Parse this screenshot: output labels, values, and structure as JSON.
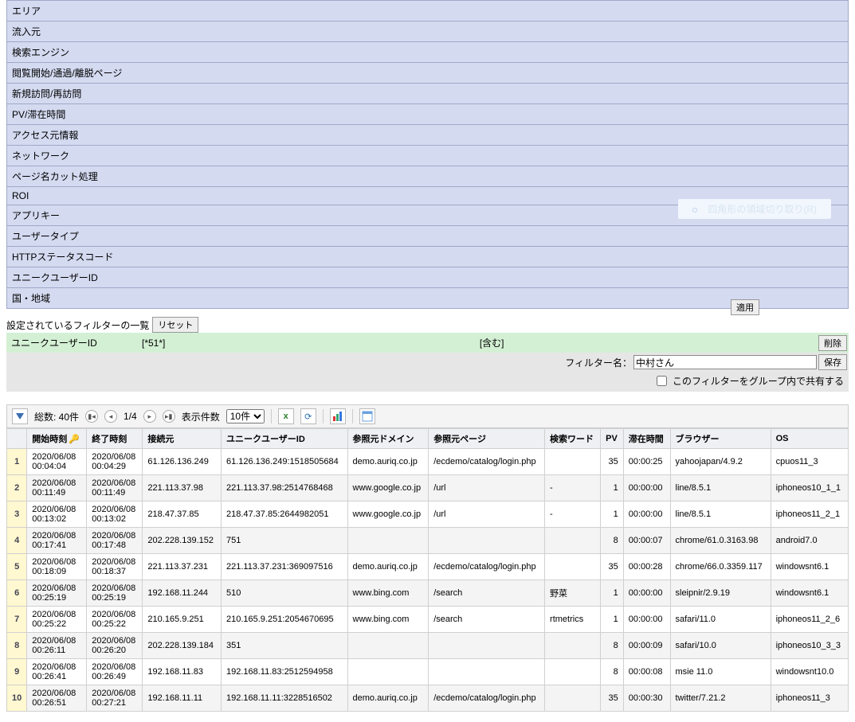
{
  "filters": [
    {
      "label": "エリア"
    },
    {
      "label": "流入元"
    },
    {
      "label": "検索エンジン"
    },
    {
      "label": "閲覧開始/通過/離脱ページ"
    },
    {
      "label": "新規訪問/再訪問"
    },
    {
      "label": "PV/滞在時間"
    },
    {
      "label": "アクセス元情報"
    },
    {
      "label": "ネットワーク"
    },
    {
      "label": "ページ名カット処理"
    },
    {
      "label": "ROI"
    },
    {
      "label": "アプリキー"
    },
    {
      "label": "ユーザータイプ"
    },
    {
      "label": "HTTPステータスコード"
    },
    {
      "label": "ユニークユーザーID"
    },
    {
      "label": "国・地域"
    }
  ],
  "filter_list": {
    "heading": "設定されているフィルターの一覧",
    "reset": "リセット",
    "apply": "適用",
    "type": "ユニークユーザーID",
    "pattern": "[*51*]",
    "mode": "[含む]",
    "delete": "削除"
  },
  "filter_name": {
    "label": "フィルター名：",
    "value": "中村さん",
    "save": "保存",
    "share": "このフィルターをグループ内で共有する"
  },
  "toolbar": {
    "total": "総数: 40件",
    "page": "1/4",
    "perpage_label": "表示件数",
    "perpage_value": "10件"
  },
  "ghost": "四角形の領域切り取り(R)",
  "columns": [
    "開始時刻",
    "終了時刻",
    "接続元",
    "ユニークユーザーID",
    "参照元ドメイン",
    "参照元ページ",
    "検索ワード",
    "PV",
    "滞在時間",
    "ブラウザー",
    "OS"
  ],
  "rows": [
    {
      "n": "1",
      "start": "2020/06/08 00:04:04",
      "end": "2020/06/08 00:04:29",
      "src": "61.126.136.249",
      "uid": "61.126.136.249:1518505684",
      "refd": "demo.auriq.co.jp",
      "refp": "/ecdemo/catalog/login.php",
      "kw": "",
      "pv": "35",
      "dur": "00:00:25",
      "br": "yahoojapan/4.9.2",
      "os": "cpuos11_3"
    },
    {
      "n": "2",
      "start": "2020/06/08 00:11:49",
      "end": "2020/06/08 00:11:49",
      "src": "221.113.37.98",
      "uid": "221.113.37.98:2514768468",
      "refd": "www.google.co.jp",
      "refp": "/url",
      "kw": "-",
      "pv": "1",
      "dur": "00:00:00",
      "br": "line/8.5.1",
      "os": "iphoneos10_1_1"
    },
    {
      "n": "3",
      "start": "2020/06/08 00:13:02",
      "end": "2020/06/08 00:13:02",
      "src": "218.47.37.85",
      "uid": "218.47.37.85:2644982051",
      "refd": "www.google.co.jp",
      "refp": "/url",
      "kw": "-",
      "pv": "1",
      "dur": "00:00:00",
      "br": "line/8.5.1",
      "os": "iphoneos11_2_1"
    },
    {
      "n": "4",
      "start": "2020/06/08 00:17:41",
      "end": "2020/06/08 00:17:48",
      "src": "202.228.139.152",
      "uid": "751",
      "refd": "",
      "refp": "",
      "kw": "",
      "pv": "8",
      "dur": "00:00:07",
      "br": "chrome/61.0.3163.98",
      "os": "android7.0"
    },
    {
      "n": "5",
      "start": "2020/06/08 00:18:09",
      "end": "2020/06/08 00:18:37",
      "src": "221.113.37.231",
      "uid": "221.113.37.231:369097516",
      "refd": "demo.auriq.co.jp",
      "refp": "/ecdemo/catalog/login.php",
      "kw": "",
      "pv": "35",
      "dur": "00:00:28",
      "br": "chrome/66.0.3359.117",
      "os": "windowsnt6.1"
    },
    {
      "n": "6",
      "start": "2020/06/08 00:25:19",
      "end": "2020/06/08 00:25:19",
      "src": "192.168.11.244",
      "uid": "510",
      "refd": "www.bing.com",
      "refp": "/search",
      "kw": "野菜",
      "pv": "1",
      "dur": "00:00:00",
      "br": "sleipnir/2.9.19",
      "os": "windowsnt6.1"
    },
    {
      "n": "7",
      "start": "2020/06/08 00:25:22",
      "end": "2020/06/08 00:25:22",
      "src": "210.165.9.251",
      "uid": "210.165.9.251:2054670695",
      "refd": "www.bing.com",
      "refp": "/search",
      "kw": "rtmetrics",
      "pv": "1",
      "dur": "00:00:00",
      "br": "safari/11.0",
      "os": "iphoneos11_2_6"
    },
    {
      "n": "8",
      "start": "2020/06/08 00:26:11",
      "end": "2020/06/08 00:26:20",
      "src": "202.228.139.184",
      "uid": "351",
      "refd": "",
      "refp": "",
      "kw": "",
      "pv": "8",
      "dur": "00:00:09",
      "br": "safari/10.0",
      "os": "iphoneos10_3_3"
    },
    {
      "n": "9",
      "start": "2020/06/08 00:26:41",
      "end": "2020/06/08 00:26:49",
      "src": "192.168.11.83",
      "uid": "192.168.11.83:2512594958",
      "refd": "",
      "refp": "",
      "kw": "",
      "pv": "8",
      "dur": "00:00:08",
      "br": "msie 11.0",
      "os": "windowsnt10.0"
    },
    {
      "n": "10",
      "start": "2020/06/08 00:26:51",
      "end": "2020/06/08 00:27:21",
      "src": "192.168.11.11",
      "uid": "192.168.11.11:3228516502",
      "refd": "demo.auriq.co.jp",
      "refp": "/ecdemo/catalog/login.php",
      "kw": "",
      "pv": "35",
      "dur": "00:00:30",
      "br": "twitter/7.21.2",
      "os": "iphoneos11_3"
    }
  ]
}
